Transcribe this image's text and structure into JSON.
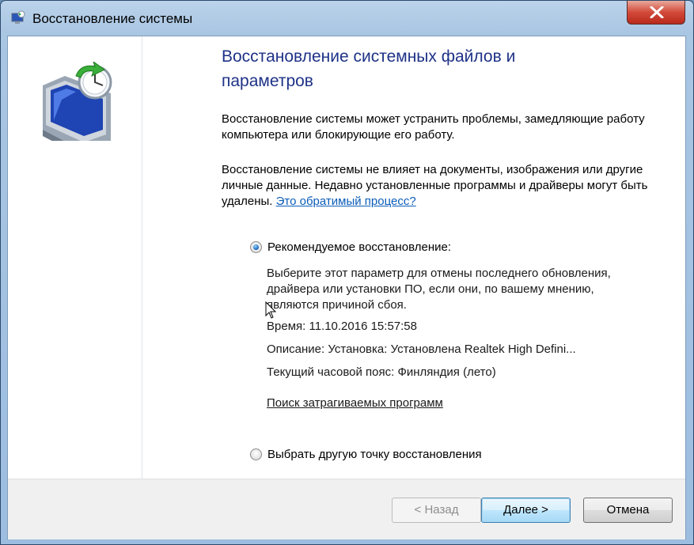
{
  "window": {
    "title": "Восстановление системы"
  },
  "main": {
    "heading": "Восстановление системных файлов и параметров",
    "intro": "Восстановление системы может устранить проблемы, замедляющие работу компьютера или блокирующие его работу.",
    "note": "Восстановление системы не влияет на документы, изображения или другие личные данные. Недавно установленные программы и драйверы могут быть удалены.",
    "reversible_link": "Это обратимый процесс?"
  },
  "recommended": {
    "label": "Рекомендуемое восстановление:",
    "selected": true,
    "description": "Выберите этот параметр для отмены последнего обновления, драйвера или установки ПО, если они, по вашему мнению, являются причиной сбоя.",
    "time": "Время: 11.10.2016 15:57:58",
    "desc_line": "Описание: Установка: Установлена Realtek High Defini...",
    "timezone": "Текущий часовой пояс: Финляндия (лето)",
    "scan_link": "Поиск затрагиваемых программ"
  },
  "other": {
    "label": "Выбрать другую точку восстановления",
    "selected": false
  },
  "buttons": {
    "back": "< Назад",
    "next": "Далее >",
    "cancel": "Отмена"
  },
  "icons": {
    "title": "system-restore-icon",
    "close": "close-icon",
    "illustration": "system-restore-monitor-icon"
  },
  "colors": {
    "heading": "#1e3287",
    "link": "#0b5cb8",
    "close_button": "#c7392a"
  }
}
